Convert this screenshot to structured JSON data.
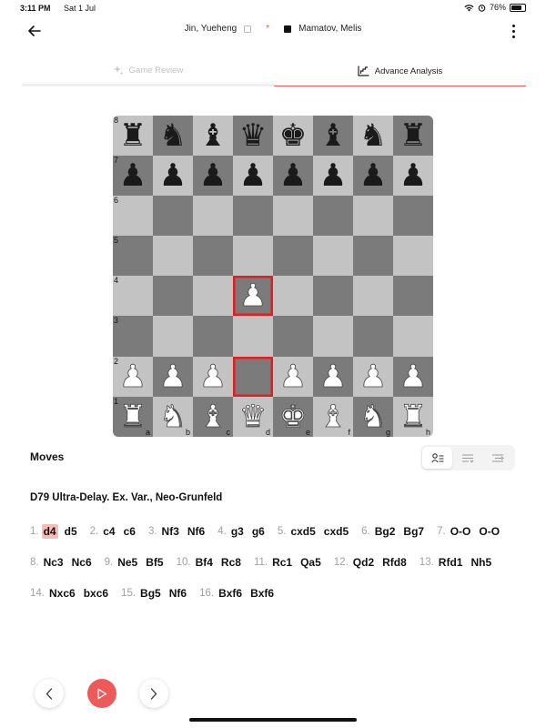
{
  "status_bar": {
    "time": "3:11 PM",
    "date": "Sat 1 Jul",
    "battery": "76%",
    "battery_level": 0.76
  },
  "header": {
    "white_player": "Jin, Yueheng",
    "black_player": "Mamatov, Melis",
    "vs_mark": "*",
    "back_icon": "arrow-left-icon",
    "menu_icon": "more-vertical-icon"
  },
  "tabs": [
    {
      "label": "Game Review",
      "icon": "sparkle-icon",
      "active": false
    },
    {
      "label": "Advance Analysis",
      "icon": "analysis-chart-icon",
      "active": true
    }
  ],
  "board": {
    "rows": [
      [
        "♜",
        "♞",
        "♝",
        "♛",
        "♚",
        "♝",
        "♞",
        "♜"
      ],
      [
        "♟",
        "♟",
        "♟",
        "♟",
        "♟",
        "♟",
        "♟",
        "♟"
      ],
      [
        "",
        "",
        "",
        "",
        "",
        "",
        "",
        ""
      ],
      [
        "",
        "",
        "",
        "",
        "",
        "",
        "",
        ""
      ],
      [
        "",
        "",
        "",
        "♟",
        "",
        "",
        "",
        ""
      ],
      [
        "",
        "",
        "",
        "",
        "",
        "",
        "",
        ""
      ],
      [
        "♟",
        "♟",
        "♟",
        "",
        "♟",
        "♟",
        "♟",
        "♟"
      ],
      [
        "♜",
        "♞",
        "♝",
        "♛",
        "♚",
        "♝",
        "♞",
        "♜"
      ]
    ],
    "colors": [
      [
        "b",
        "b",
        "b",
        "b",
        "b",
        "b",
        "b",
        "b"
      ],
      [
        "b",
        "b",
        "b",
        "b",
        "b",
        "b",
        "b",
        "b"
      ],
      [
        "",
        "",
        "",
        "",
        "",
        "",
        "",
        ""
      ],
      [
        "",
        "",
        "",
        "",
        "",
        "",
        "",
        ""
      ],
      [
        "",
        "",
        "",
        "w",
        "",
        "",
        "",
        ""
      ],
      [
        "",
        "",
        "",
        "",
        "",
        "",
        "",
        ""
      ],
      [
        "w",
        "w",
        "w",
        "",
        "w",
        "w",
        "w",
        "w"
      ],
      [
        "w",
        "w",
        "w",
        "w",
        "w",
        "w",
        "w",
        "w"
      ]
    ],
    "rank_labels": [
      "8",
      "7",
      "6",
      "5",
      "4",
      "3",
      "2",
      "1"
    ],
    "file_labels": [
      "a",
      "b",
      "c",
      "d",
      "e",
      "f",
      "g",
      "h"
    ],
    "highlight_squares": [
      "d4",
      "d2"
    ],
    "highlight_color": "#e41e1e",
    "light_square_color": "#c3c3c3",
    "dark_square_color": "#7b7b7b"
  },
  "moves_section": {
    "title": "Moves",
    "view_icons": [
      "player-list-icon",
      "list-icon",
      "text-lines-icon"
    ],
    "opening": "D79 Ultra-Delay. Ex. Var., Neo-Grunfeld",
    "moves": [
      {
        "num": "1.",
        "white": "d4",
        "black": "d5",
        "selected": "white"
      },
      {
        "num": "2.",
        "white": "c4",
        "black": "c6"
      },
      {
        "num": "3.",
        "white": "Nf3",
        "black": "Nf6"
      },
      {
        "num": "4.",
        "white": "g3",
        "black": "g6"
      },
      {
        "num": "5.",
        "white": "cxd5",
        "black": "cxd5"
      },
      {
        "num": "6.",
        "white": "Bg2",
        "black": "Bg7"
      },
      {
        "num": "7.",
        "white": "O-O",
        "black": "O-O"
      },
      {
        "num": "8.",
        "white": "Nc3",
        "black": "Nc6"
      },
      {
        "num": "9.",
        "white": "Ne5",
        "black": "Bf5"
      },
      {
        "num": "10.",
        "white": "Bf4",
        "black": "Rc8"
      },
      {
        "num": "11.",
        "white": "Rc1",
        "black": "Qa5"
      },
      {
        "num": "12.",
        "white": "Qd2",
        "black": "Rfd8"
      },
      {
        "num": "13.",
        "white": "Rfd1",
        "black": "Nh5"
      },
      {
        "num": "14.",
        "white": "Nxc6",
        "black": "bxc6"
      },
      {
        "num": "15.",
        "white": "Bg5",
        "black": "Nf6"
      },
      {
        "num": "16.",
        "white": "Bxf6",
        "black": "Bxf6"
      }
    ],
    "selected_color": "#f5bdb8"
  },
  "controls": {
    "prev_icon": "chevron-left-icon",
    "play_icon": "play-icon",
    "next_icon": "chevron-right-icon",
    "accent": "#ee5a5a"
  }
}
